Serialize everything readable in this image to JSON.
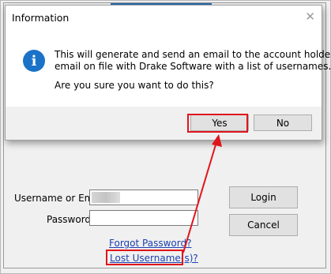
{
  "dialog": {
    "title": "Information",
    "close_glyph": "✕",
    "icon": "info-icon",
    "message_line1": "This will generate and send an email to the account holder's",
    "message_line2": "email on file with Drake Software with a list of usernames.",
    "question": "Are you sure you want to do this?",
    "yes_label": "Yes",
    "no_label": "No"
  },
  "login": {
    "username_label": "Username or Email",
    "password_label": "Password",
    "login_button": "Login",
    "cancel_button": "Cancel",
    "forgot_password": "Forgot Password?",
    "lost_username": "Lost Username(s)?"
  },
  "colors": {
    "annotation_red": "#e0141b",
    "info_blue": "#1a73c8",
    "link_blue": "#1a3fb0"
  }
}
